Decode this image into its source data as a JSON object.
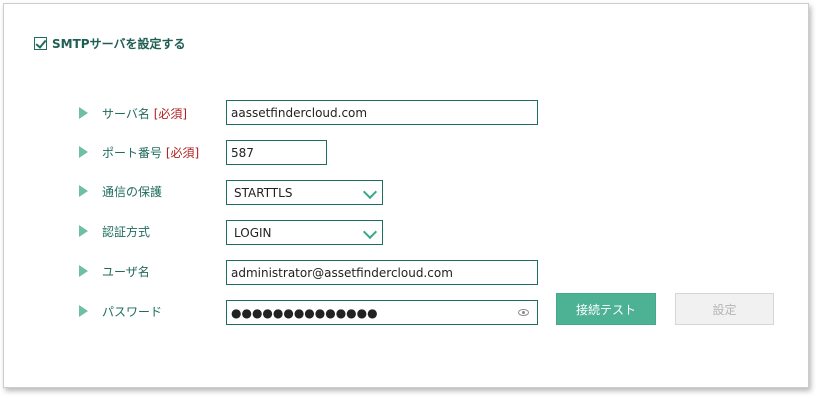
{
  "smtp": {
    "enable_label": "SMTPサーバを設定する",
    "enabled": true
  },
  "fields": {
    "server": {
      "label": "サーバ名",
      "required": "[必須]",
      "value": "aassetfindercloud.com"
    },
    "port": {
      "label": "ポート番号",
      "required": "[必須]",
      "value": "587"
    },
    "security": {
      "label": "通信の保護",
      "value": "STARTTLS"
    },
    "auth": {
      "label": "認証方式",
      "value": "LOGIN"
    },
    "username": {
      "label": "ユーザ名",
      "value": "administrator@assetfindercloud.com"
    },
    "password": {
      "label": "パスワード",
      "value": "●●●●●●●●●●●●●●"
    }
  },
  "buttons": {
    "test_label": "接続テスト",
    "save_label": "設定"
  },
  "colors": {
    "accent": "#4db294",
    "label_text": "#1f6b5c",
    "required": "#b22222",
    "field_border": "#1f6e5d"
  },
  "icons": [
    "checkbox-check-icon",
    "row-arrow-icon",
    "chevron-down-icon",
    "eye-icon"
  ]
}
